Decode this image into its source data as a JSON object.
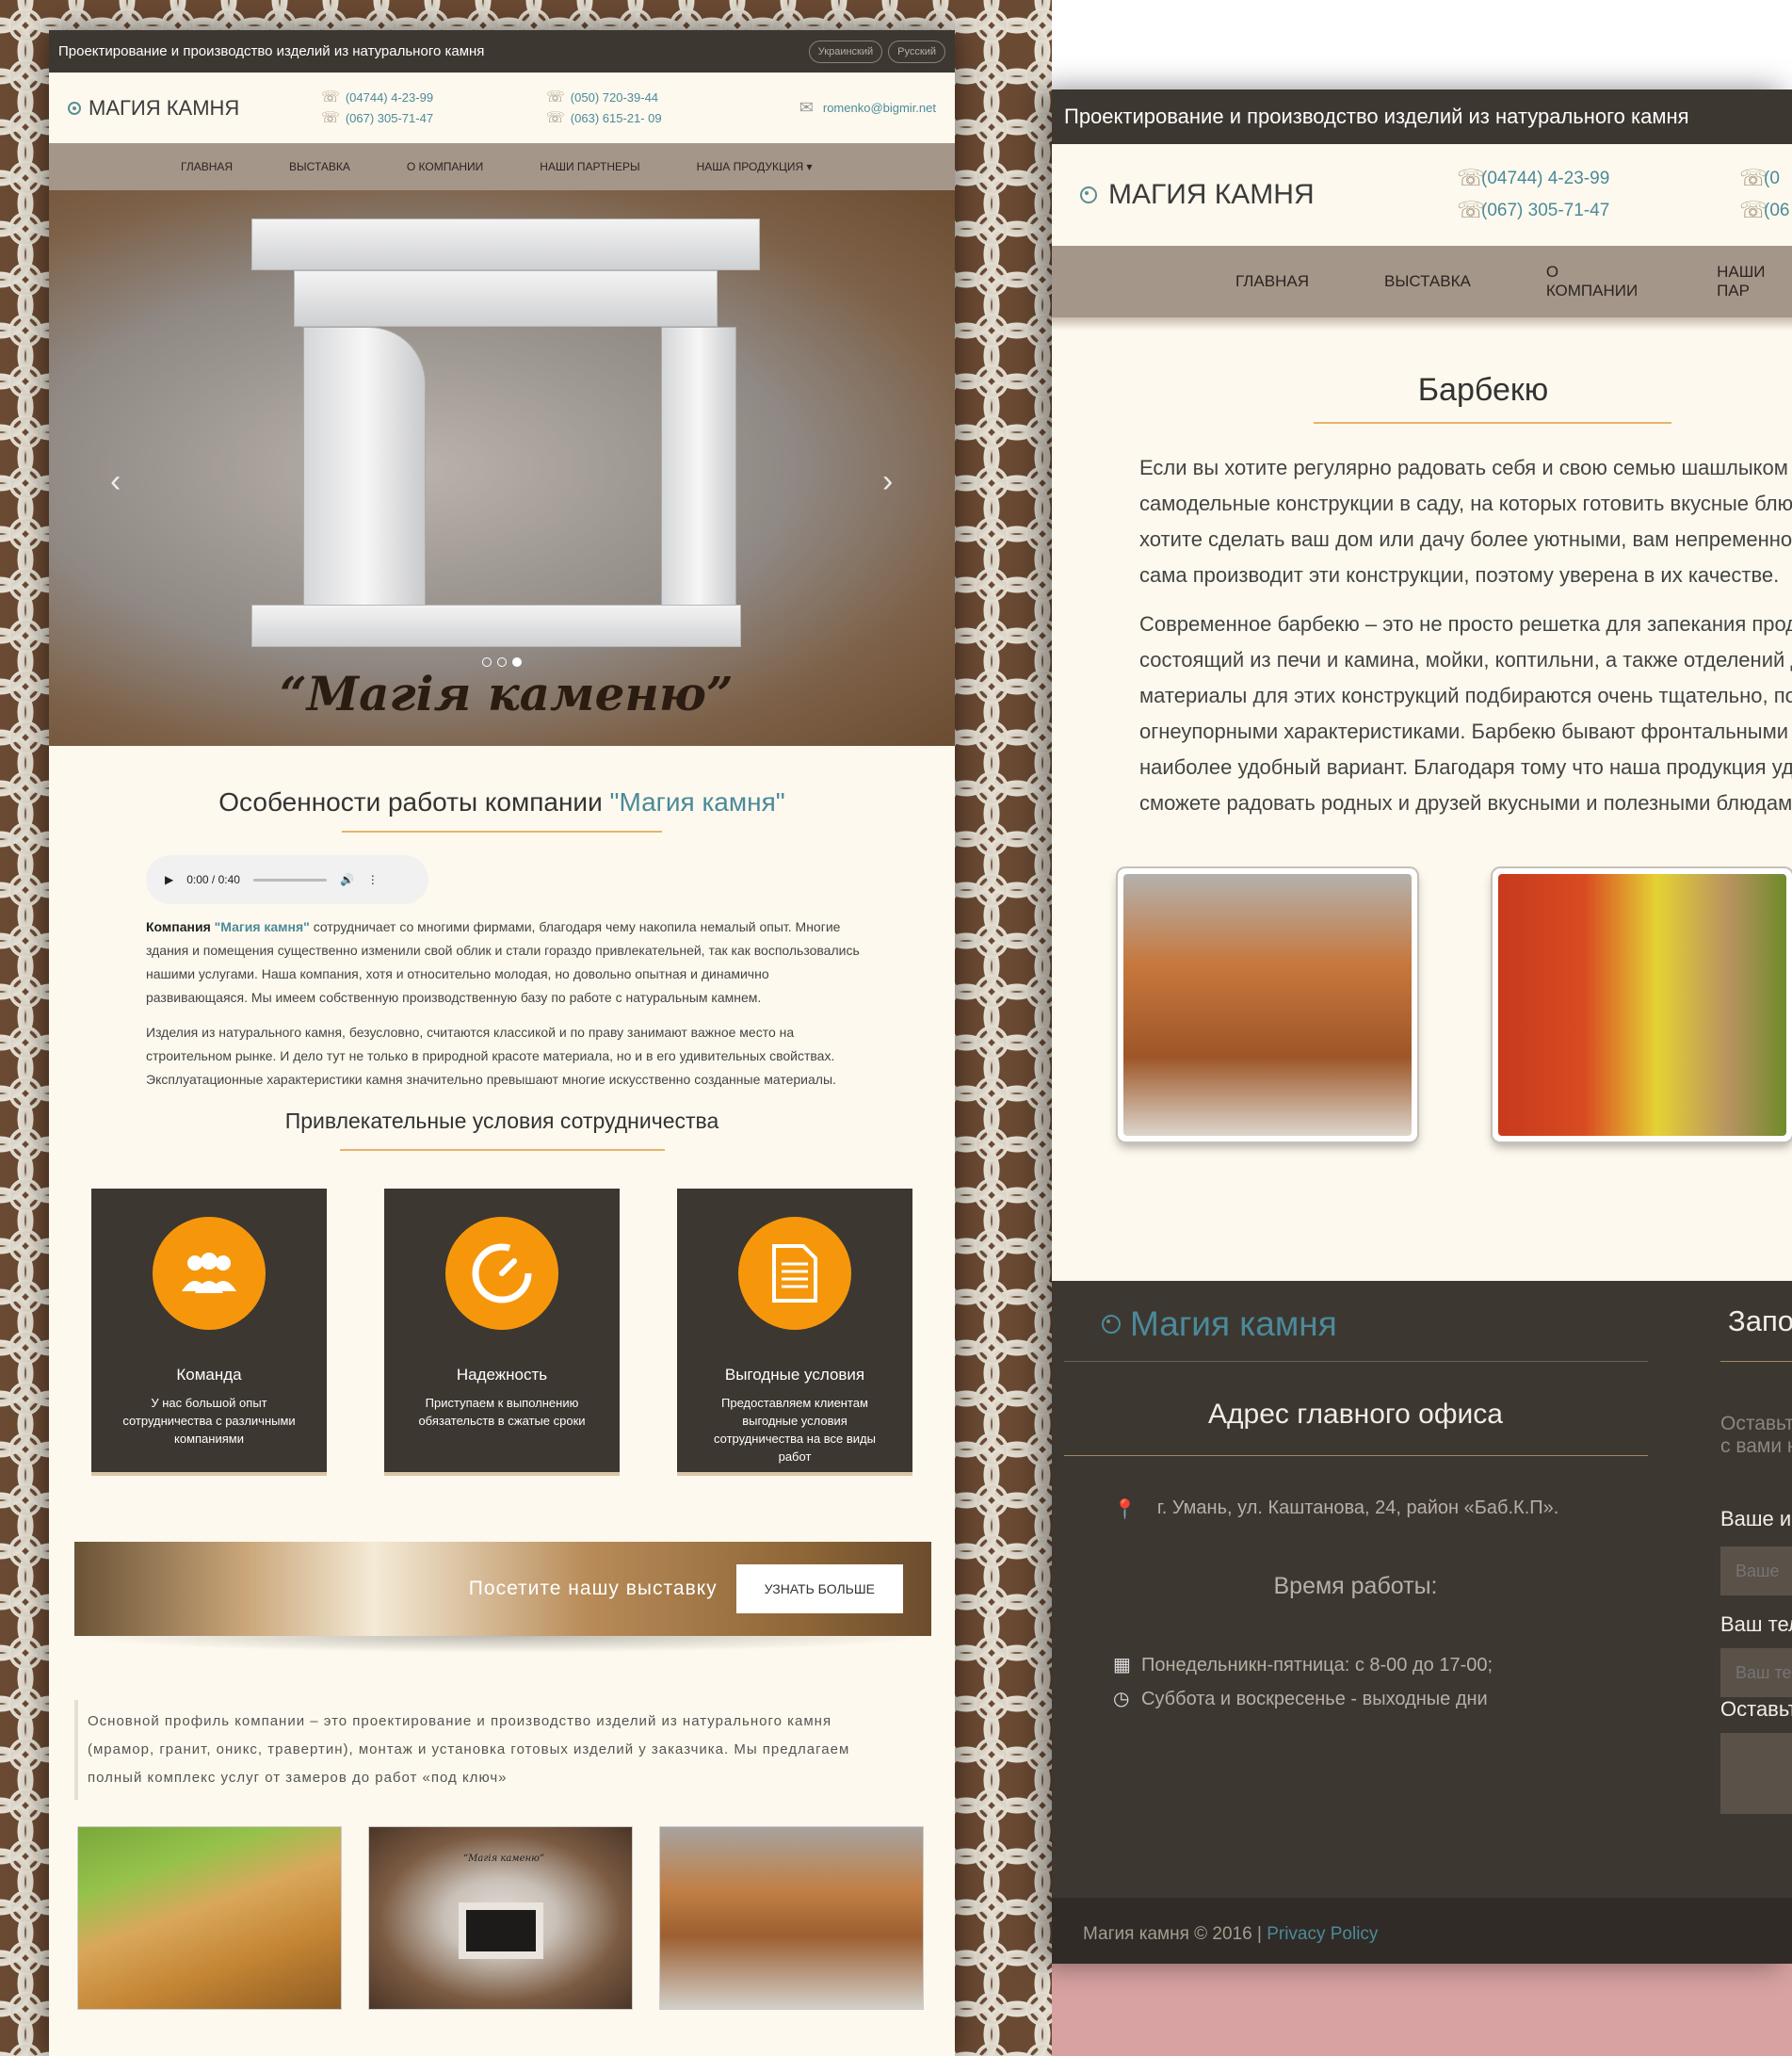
{
  "left_page": {
    "topbar": {
      "tagline": "Проектирование и производство изделий из натурального камня",
      "languages": [
        "Украинский",
        "Русский"
      ]
    },
    "header": {
      "logo": "МАГИЯ КАМНЯ",
      "phones_col1": [
        "(04744) 4-23-99",
        "(067) 305-71-47"
      ],
      "phones_col2": [
        "(050) 720-39-44",
        "(063) 615-21- 09"
      ],
      "email": "romenko@bigmir.net"
    },
    "nav": [
      "ГЛАВНАЯ",
      "ВЫСТАВКА",
      "О КОМПАНИИ",
      "НАШИ ПАРТНЕРЫ",
      "НАША ПРОДУКЦИЯ ▾"
    ],
    "hero": {
      "caption": "“Магія каменю”",
      "slides_total": 3,
      "active_slide": 3
    },
    "features_section": {
      "title_prefix": "Особенности работы компании ",
      "title_accent": "\"Магия камня\"",
      "audio_time": "0:00 / 0:40",
      "para1_bold": "Компания ",
      "para1_accent": "\"Магия камня\"",
      "para1_rest": " сотрудничает со многими фирмами, благодаря чему накопила немалый опыт. Многие здания и помещения существенно изменили свой облик и стали гораздо привлекательней, так как воспользовались нашими услугами. Наша компания, хотя и относительно молодая, но довольно опытная и динамично развивающаяся. Мы имеем собственную производственную базу по работе с натуральным камнем.",
      "para2": "Изделия из натурального камня, безусловно, считаются классикой и по праву занимают важное место на строительном рынке. И дело тут не только в природной красоте материала, но и в его удивительных свойствах. Эксплуатационные характеристики камня значительно превышают многие искусственно созданные материалы."
    },
    "conditions": {
      "title": "Привлекательные условия сотрудничества",
      "items": [
        {
          "icon": "team-icon",
          "title": "Команда",
          "text": "У нас большой опыт сотрудничества с различными компаниями"
        },
        {
          "icon": "speedometer-icon",
          "title": "Надежность",
          "text": "Приступаем к выполнению обязательств в сжатые сроки"
        },
        {
          "icon": "document-icon",
          "title": "Выгодные условия",
          "text": "Предоставляем клиентам выгодные условия сотрудничества на все виды работ"
        }
      ]
    },
    "cta": {
      "text": "Посетите нашу выставку",
      "button": "УЗНАТЬ БОЛЬШЕ"
    },
    "profile": "Основной профиль компании – это проектирование и производство изделий из натурального камня (мрамор, гранит, оникс, травертин), монтаж и установка готовых изделий у заказчика. Мы предлагаем полный комплекс услуг от замеров до работ «под ключ»",
    "gallery_caption": "“Магія каменю”"
  },
  "right_page": {
    "topbar": "Проектирование и производство изделий из натурального камня",
    "logo": "МАГИЯ КАМНЯ",
    "phones_col1": [
      "(04744) 4-23-99",
      "(067) 305-71-47"
    ],
    "phones_col2": [
      "(0",
      "(06"
    ],
    "nav": [
      "ГЛАВНАЯ",
      "ВЫСТАВКА",
      "О КОМПАНИИ",
      "НАШИ ПАР"
    ],
    "title": "Барбекю",
    "para1": [
      "Если вы хотите регулярно радовать себя и свою семью шашлыком и",
      "самодельные конструкции в саду, на которых готовить вкусные блюда",
      "хотите сделать ваш дом или дачу более уютными, вам непременно н",
      "сама производит эти конструкции, поэтому уверена в их качестве."
    ],
    "para2": [
      "Современное барбекю – это не просто решетка для запекания проду",
      "состоящий из печи и камина, мойки, коптильни, а также отделений дл",
      "материалы для этих конструкций подбираются очень тщательно, поэт",
      "огнеупорными характеристиками. Барбекю бывают фронтальными и",
      "наиболее удобный вариант. Благодаря тому что наша продукция удоб",
      "сможете радовать родных и друзей вкусными и полезными блюдами."
    ],
    "footer": {
      "logo": "Магия камня",
      "address_title": "Адрес главного офиса",
      "address": "г. Умань, ул. Каштанова, 24, район «Баб.К.П».",
      "hours_title": "Время работы:",
      "hours": [
        "Понедельникн-пятница: с 8-00 до 17-00;",
        "Суббота и воскресенье - выходные дни"
      ],
      "form_title": "Запо",
      "form_note": [
        "Оставьт",
        "с вами н"
      ],
      "label_name": "Ваше и",
      "placeholder_name": "Ваше",
      "label_phone": "Ваш тел",
      "placeholder_phone": "Ваш те",
      "label_message": "Оставьт",
      "copyright": "Магия камня © 2016 | ",
      "privacy": "Privacy Policy"
    }
  }
}
